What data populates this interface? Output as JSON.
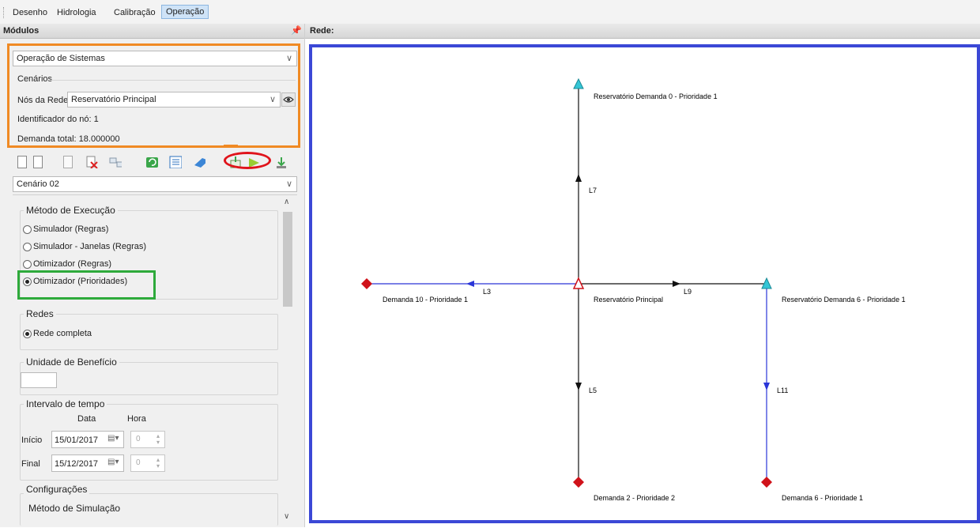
{
  "menu": {
    "items": [
      "Desenho",
      "Hidrologia",
      "Calibração",
      "Operação"
    ],
    "active": "Operação"
  },
  "left_panel": {
    "title": "Módulos",
    "module_select": "Operação de Sistemas",
    "scenarios_label": "Cenários",
    "network_nodes_label": "Nós da Rede",
    "network_nodes_value": "Reservatório Principal",
    "node_id_text": "Identificador do nó: 1",
    "total_demand_text": "Demanda total: 18.000000",
    "scenario_select": "Cenário 02",
    "execution_method": {
      "title": "Método de Execução",
      "options": [
        "Simulador (Regras)",
        "Simulador - Janelas (Regras)",
        "Otimizador (Regras)",
        "Otimizador (Prioridades)"
      ],
      "selected": "Otimizador (Prioridades)"
    },
    "networks": {
      "title": "Redes",
      "option": "Rede completa"
    },
    "benefit_unit": {
      "title": "Unidade de Benefício",
      "value": ""
    },
    "time_interval": {
      "title": "Intervalo de tempo",
      "col_date": "Data",
      "col_hour": "Hora",
      "start_label": "Início",
      "start_date": "15/01/2017",
      "start_hour": "0",
      "end_label": "Final",
      "end_date": "15/12/2017",
      "end_hour": "0"
    },
    "settings": {
      "title": "Configurações",
      "sub": "Método de Simulação"
    }
  },
  "network": {
    "title": "Rede:",
    "nodes": {
      "res_demanda0": "Reservatório Demanda 0 - Prioridade 1",
      "res_principal": "Reservatório Principal",
      "res_demanda6": "Reservatório Demanda 6 - Prioridade 1",
      "demanda10": "Demanda 10 - Prioridade 1",
      "demanda2": "Demanda 2 - Prioridade 2",
      "demanda6": "Demanda 6 - Prioridade 1"
    },
    "links": {
      "L7": "L7",
      "L3": "L3",
      "L9": "L9",
      "L5": "L5",
      "L11": "L11"
    }
  },
  "colors": {
    "highlight_orange": "#f08a24",
    "highlight_green": "#2eaa3b",
    "highlight_red": "#e0141b",
    "canvas_border": "#3b48d6",
    "reservoir": "#35c6d6",
    "demand": "#d0121a",
    "link_blue": "#2a35d8"
  },
  "icons": [
    "new-doc-icon",
    "copy-doc-icon",
    "page-icon",
    "delete-doc-icon",
    "link-icon",
    "refresh-icon",
    "list-icon",
    "eraser-icon",
    "export-icon",
    "run-icon",
    "import-icon",
    "eye-icon"
  ]
}
